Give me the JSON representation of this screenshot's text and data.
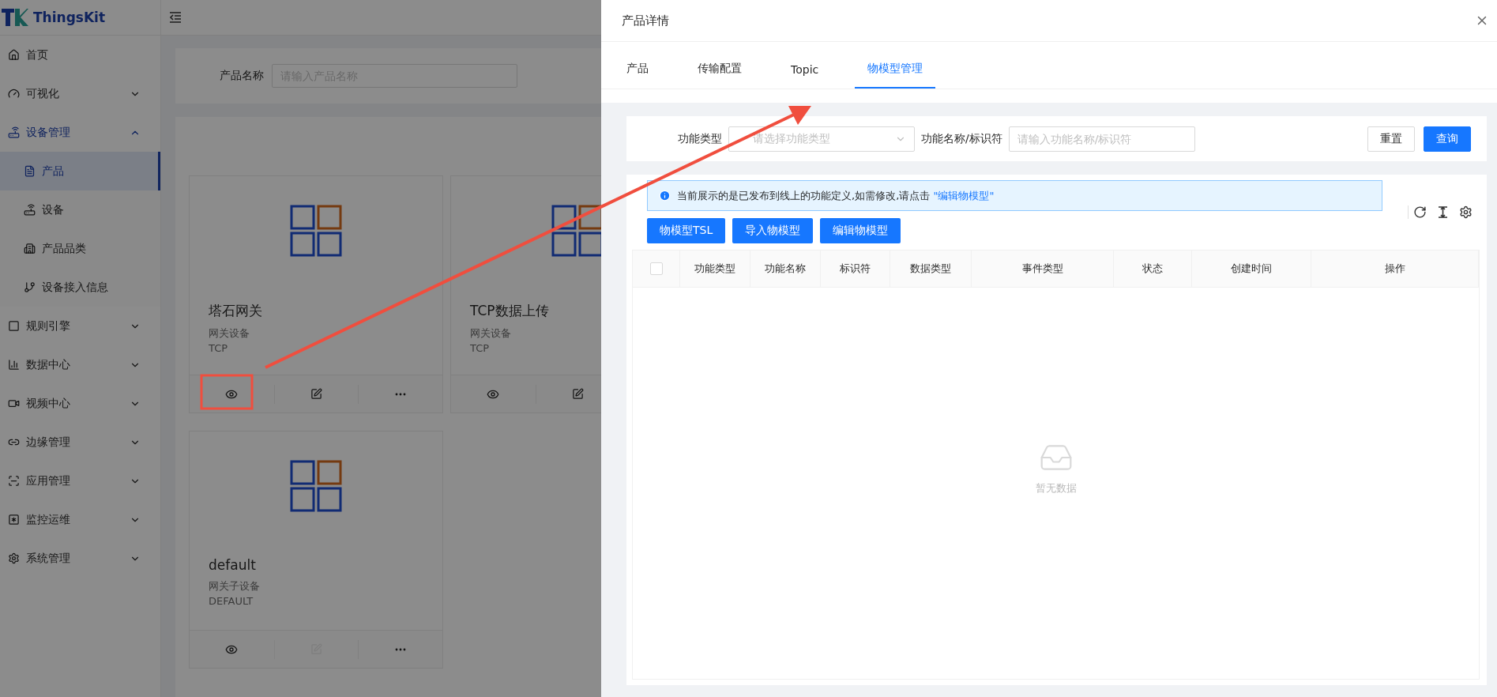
{
  "sidebar": {
    "logo": "ThingsKit",
    "items": [
      {
        "label": "首页",
        "kind": "link",
        "selected": false
      },
      {
        "label": "可视化",
        "kind": "submenu",
        "selected": false,
        "expanded": false
      },
      {
        "label": "设备管理",
        "kind": "submenu",
        "selected": true,
        "expanded": true,
        "children": [
          {
            "label": "产品",
            "selected": true
          },
          {
            "label": "设备",
            "selected": false
          },
          {
            "label": "产品品类",
            "selected": false
          },
          {
            "label": "设备接入信息",
            "selected": false
          }
        ]
      },
      {
        "label": "规则引擎",
        "kind": "submenu",
        "selected": false,
        "expanded": false
      },
      {
        "label": "数据中心",
        "kind": "submenu",
        "selected": false,
        "expanded": false
      },
      {
        "label": "视频中心",
        "kind": "submenu",
        "selected": false,
        "expanded": false
      },
      {
        "label": "边缘管理",
        "kind": "submenu",
        "selected": false,
        "expanded": false
      },
      {
        "label": "应用管理",
        "kind": "submenu",
        "selected": false,
        "expanded": false
      },
      {
        "label": "监控运维",
        "kind": "submenu",
        "selected": false,
        "expanded": false
      },
      {
        "label": "系统管理",
        "kind": "submenu",
        "selected": false,
        "expanded": false
      }
    ]
  },
  "search": {
    "label": "产品名称",
    "placeholder": "请输入产品名称"
  },
  "products": [
    {
      "name": "塔石网关",
      "type": "网关设备",
      "protocol": "TCP",
      "actions": [
        {
          "kind": "view",
          "disabled": false
        },
        {
          "kind": "edit",
          "disabled": false
        },
        {
          "kind": "more",
          "disabled": false
        }
      ]
    },
    {
      "name": "TCP数据上传",
      "type": "网关设备",
      "protocol": "TCP",
      "actions": [
        {
          "kind": "view",
          "disabled": false
        },
        {
          "kind": "edit",
          "disabled": false
        }
      ]
    },
    {
      "name": "default",
      "type": "网关子设备",
      "protocol": "DEFAULT",
      "actions": [
        {
          "kind": "view",
          "disabled": false
        },
        {
          "kind": "edit",
          "disabled": true
        },
        {
          "kind": "more",
          "disabled": false
        }
      ]
    }
  ],
  "drawer": {
    "title": "产品详情",
    "tabs": [
      {
        "label": "产品",
        "selected": false
      },
      {
        "label": "传输配置",
        "selected": false
      },
      {
        "label": "Topic",
        "selected": false
      },
      {
        "label": "物模型管理",
        "selected": true
      }
    ],
    "filters": {
      "type_label": "功能类型",
      "type_placeholder": "请选择功能类型",
      "name_label": "功能名称/标识符",
      "name_placeholder": "请输入功能名称/标识符",
      "reset": "重置",
      "query": "查询"
    },
    "alert": {
      "text": "当前展示的是已发布到线上的功能定义,如需修改,请点击",
      "link": "\"编辑物模型\""
    },
    "buttons": [
      "物模型TSL",
      "导入物模型",
      "编辑物模型"
    ],
    "table": {
      "select_all_checked": false,
      "columns": [
        "功能类型",
        "功能名称",
        "标识符",
        "数据类型",
        "事件类型",
        "状态",
        "创建时间",
        "操作"
      ],
      "empty": "暂无数据"
    }
  }
}
